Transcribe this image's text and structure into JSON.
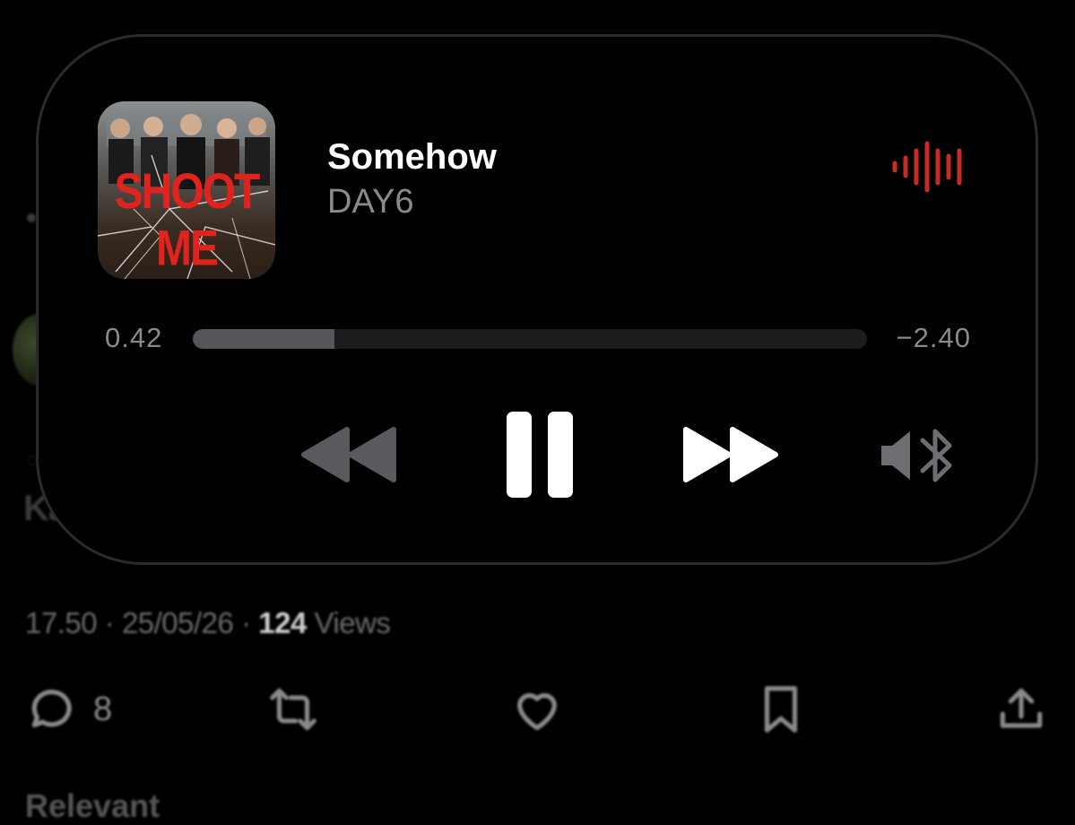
{
  "background_tweet": {
    "handle_partial": "Ka",
    "time": "17.50",
    "date": "25/05/26",
    "views_count": "124",
    "views_label": "Views",
    "separator": "·",
    "reply_count": "8",
    "relevant_label": "Relevant"
  },
  "player": {
    "album_art_text": "SHOOT ME",
    "song_title": "Somehow",
    "artist": "DAY6",
    "elapsed": "0.42",
    "remaining": "−2.40",
    "progress": 0.21,
    "accent_color": "#c62b26",
    "icons": {
      "waveform": "waveform-icon",
      "rewind": "rewind-icon",
      "pause": "pause-icon",
      "forward": "fast-forward-icon",
      "output": "speaker-bluetooth-icon"
    }
  }
}
